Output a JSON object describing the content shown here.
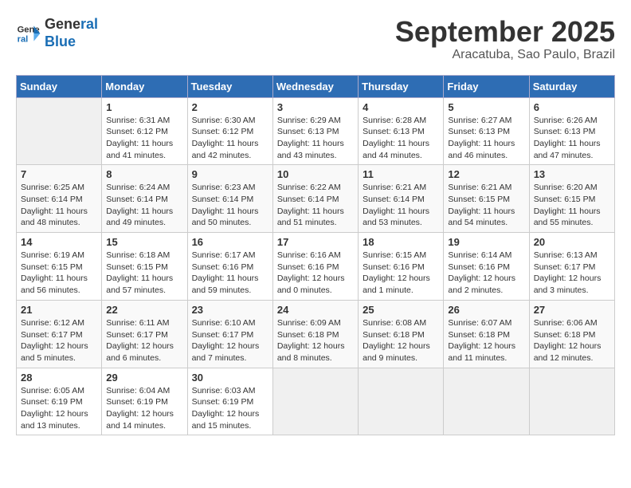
{
  "header": {
    "logo_line1": "General",
    "logo_line2": "Blue",
    "month": "September 2025",
    "location": "Aracatuba, Sao Paulo, Brazil"
  },
  "weekdays": [
    "Sunday",
    "Monday",
    "Tuesday",
    "Wednesday",
    "Thursday",
    "Friday",
    "Saturday"
  ],
  "weeks": [
    [
      {
        "day": "",
        "info": ""
      },
      {
        "day": "1",
        "info": "Sunrise: 6:31 AM\nSunset: 6:12 PM\nDaylight: 11 hours\nand 41 minutes."
      },
      {
        "day": "2",
        "info": "Sunrise: 6:30 AM\nSunset: 6:12 PM\nDaylight: 11 hours\nand 42 minutes."
      },
      {
        "day": "3",
        "info": "Sunrise: 6:29 AM\nSunset: 6:13 PM\nDaylight: 11 hours\nand 43 minutes."
      },
      {
        "day": "4",
        "info": "Sunrise: 6:28 AM\nSunset: 6:13 PM\nDaylight: 11 hours\nand 44 minutes."
      },
      {
        "day": "5",
        "info": "Sunrise: 6:27 AM\nSunset: 6:13 PM\nDaylight: 11 hours\nand 46 minutes."
      },
      {
        "day": "6",
        "info": "Sunrise: 6:26 AM\nSunset: 6:13 PM\nDaylight: 11 hours\nand 47 minutes."
      }
    ],
    [
      {
        "day": "7",
        "info": "Sunrise: 6:25 AM\nSunset: 6:14 PM\nDaylight: 11 hours\nand 48 minutes."
      },
      {
        "day": "8",
        "info": "Sunrise: 6:24 AM\nSunset: 6:14 PM\nDaylight: 11 hours\nand 49 minutes."
      },
      {
        "day": "9",
        "info": "Sunrise: 6:23 AM\nSunset: 6:14 PM\nDaylight: 11 hours\nand 50 minutes."
      },
      {
        "day": "10",
        "info": "Sunrise: 6:22 AM\nSunset: 6:14 PM\nDaylight: 11 hours\nand 51 minutes."
      },
      {
        "day": "11",
        "info": "Sunrise: 6:21 AM\nSunset: 6:14 PM\nDaylight: 11 hours\nand 53 minutes."
      },
      {
        "day": "12",
        "info": "Sunrise: 6:21 AM\nSunset: 6:15 PM\nDaylight: 11 hours\nand 54 minutes."
      },
      {
        "day": "13",
        "info": "Sunrise: 6:20 AM\nSunset: 6:15 PM\nDaylight: 11 hours\nand 55 minutes."
      }
    ],
    [
      {
        "day": "14",
        "info": "Sunrise: 6:19 AM\nSunset: 6:15 PM\nDaylight: 11 hours\nand 56 minutes."
      },
      {
        "day": "15",
        "info": "Sunrise: 6:18 AM\nSunset: 6:15 PM\nDaylight: 11 hours\nand 57 minutes."
      },
      {
        "day": "16",
        "info": "Sunrise: 6:17 AM\nSunset: 6:16 PM\nDaylight: 11 hours\nand 59 minutes."
      },
      {
        "day": "17",
        "info": "Sunrise: 6:16 AM\nSunset: 6:16 PM\nDaylight: 12 hours\nand 0 minutes."
      },
      {
        "day": "18",
        "info": "Sunrise: 6:15 AM\nSunset: 6:16 PM\nDaylight: 12 hours\nand 1 minute."
      },
      {
        "day": "19",
        "info": "Sunrise: 6:14 AM\nSunset: 6:16 PM\nDaylight: 12 hours\nand 2 minutes."
      },
      {
        "day": "20",
        "info": "Sunrise: 6:13 AM\nSunset: 6:17 PM\nDaylight: 12 hours\nand 3 minutes."
      }
    ],
    [
      {
        "day": "21",
        "info": "Sunrise: 6:12 AM\nSunset: 6:17 PM\nDaylight: 12 hours\nand 5 minutes."
      },
      {
        "day": "22",
        "info": "Sunrise: 6:11 AM\nSunset: 6:17 PM\nDaylight: 12 hours\nand 6 minutes."
      },
      {
        "day": "23",
        "info": "Sunrise: 6:10 AM\nSunset: 6:17 PM\nDaylight: 12 hours\nand 7 minutes."
      },
      {
        "day": "24",
        "info": "Sunrise: 6:09 AM\nSunset: 6:18 PM\nDaylight: 12 hours\nand 8 minutes."
      },
      {
        "day": "25",
        "info": "Sunrise: 6:08 AM\nSunset: 6:18 PM\nDaylight: 12 hours\nand 9 minutes."
      },
      {
        "day": "26",
        "info": "Sunrise: 6:07 AM\nSunset: 6:18 PM\nDaylight: 12 hours\nand 11 minutes."
      },
      {
        "day": "27",
        "info": "Sunrise: 6:06 AM\nSunset: 6:18 PM\nDaylight: 12 hours\nand 12 minutes."
      }
    ],
    [
      {
        "day": "28",
        "info": "Sunrise: 6:05 AM\nSunset: 6:19 PM\nDaylight: 12 hours\nand 13 minutes."
      },
      {
        "day": "29",
        "info": "Sunrise: 6:04 AM\nSunset: 6:19 PM\nDaylight: 12 hours\nand 14 minutes."
      },
      {
        "day": "30",
        "info": "Sunrise: 6:03 AM\nSunset: 6:19 PM\nDaylight: 12 hours\nand 15 minutes."
      },
      {
        "day": "",
        "info": ""
      },
      {
        "day": "",
        "info": ""
      },
      {
        "day": "",
        "info": ""
      },
      {
        "day": "",
        "info": ""
      }
    ]
  ]
}
